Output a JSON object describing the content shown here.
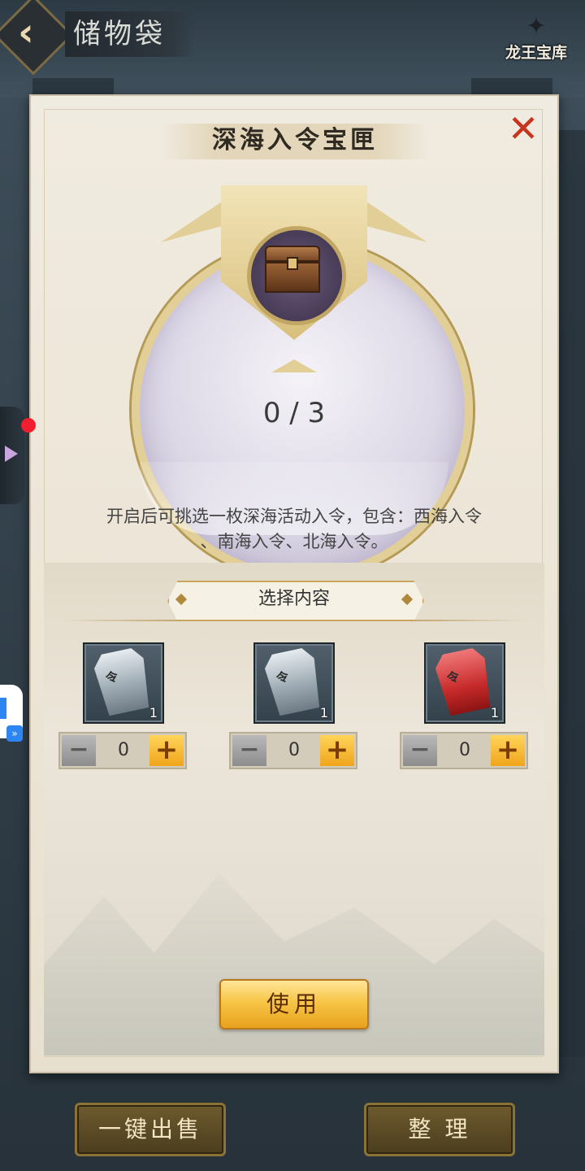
{
  "header": {
    "back_icon": "chevron-left-icon",
    "title": "储物袋",
    "vault_label": "龙王宝库"
  },
  "modal": {
    "title": "深海入令宝匣",
    "close_icon": "close-icon",
    "item_icon": "treasure-chest-icon",
    "progress": "0 / 3",
    "description_line1": "开启后可挑选一枚深海活动入令，包含：西海入令",
    "description_line2": "、南海入令、北海入令。",
    "section_title": "选择内容",
    "options": [
      {
        "icon": "silver-token-icon",
        "count": "1",
        "quantity": "0",
        "color": "#9aa7b0"
      },
      {
        "icon": "silver-token-icon",
        "count": "1",
        "quantity": "0",
        "color": "#9aa7b0"
      },
      {
        "icon": "red-token-icon",
        "count": "1",
        "quantity": "0",
        "color": "#c72a2a"
      }
    ],
    "use_label": "使用"
  },
  "footer": {
    "sell_all_label": "一键出售",
    "sort_label": "整 理"
  },
  "colors": {
    "accent_gold": "#f7c546",
    "close_red": "#c8351f",
    "notification_dot": "#f01e2e"
  }
}
